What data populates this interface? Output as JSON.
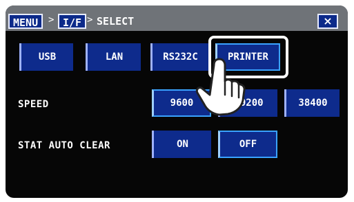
{
  "breadcrumb": {
    "menu": "MENU",
    "iface": "I/F",
    "current": "SELECT",
    "sep1": ">",
    "sep2": ">"
  },
  "close_label": "×",
  "interfaces": [
    "USB",
    "LAN",
    "RS232C",
    "PRINTER"
  ],
  "speed": {
    "label": "SPEED",
    "options": [
      "9600",
      "19200",
      "38400"
    ]
  },
  "stat_auto_clear": {
    "label": "STAT AUTO CLEAR",
    "options": [
      "ON",
      "OFF"
    ]
  }
}
